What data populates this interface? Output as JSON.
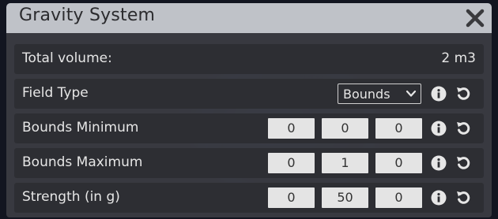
{
  "window": {
    "title": "Gravity System"
  },
  "rows": {
    "total_volume": {
      "label": "Total volume:",
      "value": "2 m3"
    },
    "field_type": {
      "label": "Field Type",
      "selected": "Bounds"
    },
    "bounds_minimum": {
      "label": "Bounds Minimum",
      "values": [
        "0",
        "0",
        "0"
      ]
    },
    "bounds_maximum": {
      "label": "Bounds Maximum",
      "values": [
        "0",
        "1",
        "0"
      ]
    },
    "strength": {
      "label": "Strength (in g)",
      "values": [
        "0",
        "50",
        "0"
      ]
    }
  },
  "icons": {
    "close": "close-icon",
    "info": "info-icon",
    "reset": "reset-icon",
    "dropdown": "chevron-down-icon"
  },
  "colors": {
    "titlebar": "#bfc2c8",
    "panel": "#3a3c42",
    "row": "#2d2e33",
    "text": "#e6e6e6",
    "input": "#e4e4e4"
  }
}
